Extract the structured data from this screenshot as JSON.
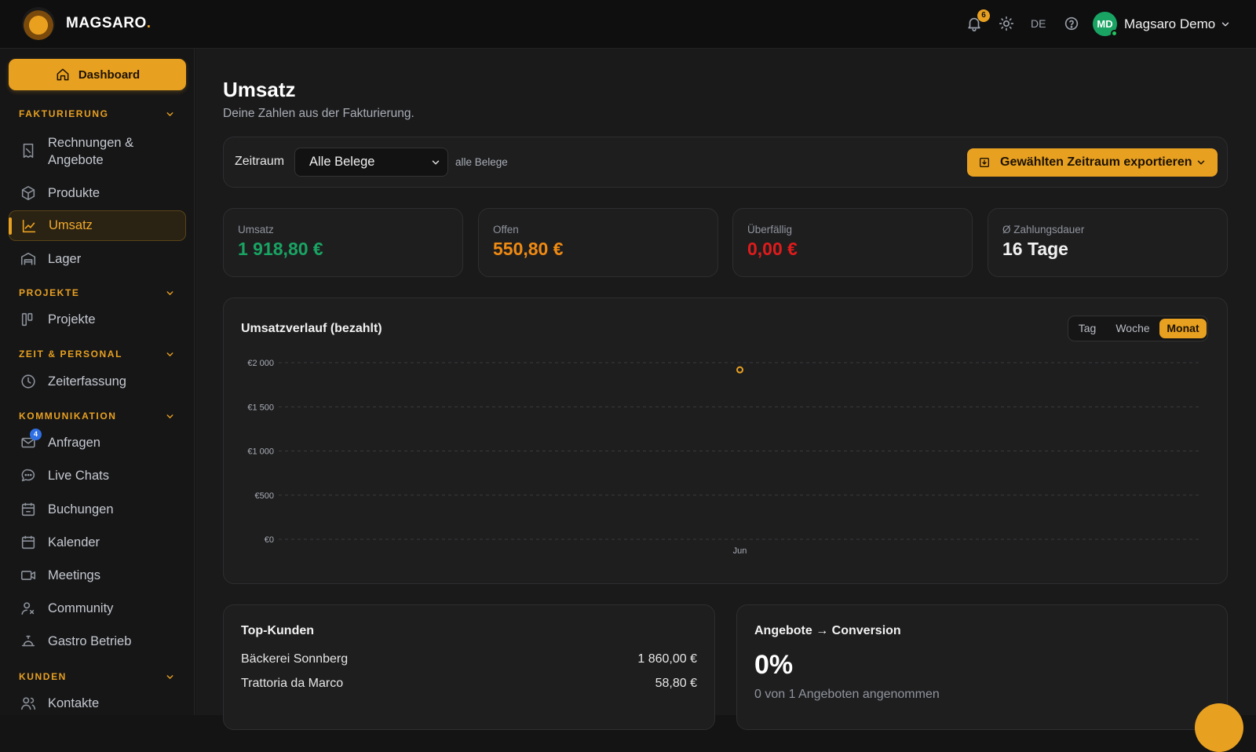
{
  "brand": {
    "name": "MAGSARO",
    "dot": "."
  },
  "topbar": {
    "notification_count": "6",
    "language": "DE",
    "avatar_initials": "MD",
    "user_name": "Magsaro Demo"
  },
  "sidebar": {
    "dashboard_label": "Dashboard",
    "sections": {
      "fakturierung": "FAKTURIERUNG",
      "projekte": "PROJEKTE",
      "zeit": "ZEIT & PERSONAL",
      "kommunikation": "KOMMUNIKATION",
      "kunden": "KUNDEN"
    },
    "items": {
      "rechnungen": [
        "Rechnungen &",
        "Angebote"
      ],
      "produkte": "Produkte",
      "umsatz": "Umsatz",
      "lager": "Lager",
      "projekte": "Projekte",
      "zeiterfassung": "Zeiterfassung",
      "anfragen": "Anfragen",
      "anfragen_badge": "4",
      "livechats": "Live Chats",
      "buchungen": "Buchungen",
      "kalender": "Kalender",
      "meetings": "Meetings",
      "community": "Community",
      "gastro": "Gastro Betrieb",
      "kontakte": "Kontakte"
    }
  },
  "page": {
    "title": "Umsatz",
    "subtitle": "Deine Zahlen aus der Fakturierung."
  },
  "filter": {
    "label": "Zeitraum",
    "selected": "Alle Belege",
    "hint": "alle Belege",
    "export_label": "Gewählten Zeitraum exportieren"
  },
  "kpis": [
    {
      "label": "Umsatz",
      "value": "1 918,80 €",
      "color": "#19a463"
    },
    {
      "label": "Offen",
      "value": "550,80 €",
      "color": "#ef8a12"
    },
    {
      "label": "Überfällig",
      "value": "0,00 €",
      "color": "#e01b1b"
    },
    {
      "label": "Ø Zahlungsdauer",
      "value": "16 Tage",
      "color": "#f2f2f2"
    }
  ],
  "chart": {
    "title": "Umsatzverlauf (bezahlt)",
    "toggle": [
      "Tag",
      "Woche",
      "Monat"
    ],
    "active_toggle": "Monat"
  },
  "chart_data": {
    "type": "line",
    "x": [
      "Jun"
    ],
    "series": [
      {
        "values": [
          1918.8
        ]
      }
    ],
    "ylim": [
      0,
      2000
    ],
    "yticks": [
      0,
      500,
      1000,
      1500,
      2000
    ],
    "ytick_labels": [
      "€0",
      "€500",
      "€1 000",
      "€1 500",
      "€2 000"
    ],
    "grid": true,
    "color": "#e8a020"
  },
  "top_kunden": {
    "title": "Top-Kunden",
    "rows": [
      {
        "name": "Bäckerei Sonnberg",
        "value": "1 860,00 €"
      },
      {
        "name": "Trattoria da Marco",
        "value": "58,80 €"
      }
    ]
  },
  "conversion": {
    "title": "Angebote → Conversion",
    "percent": "0%",
    "detail": "0 von 1 Angeboten angenommen"
  }
}
